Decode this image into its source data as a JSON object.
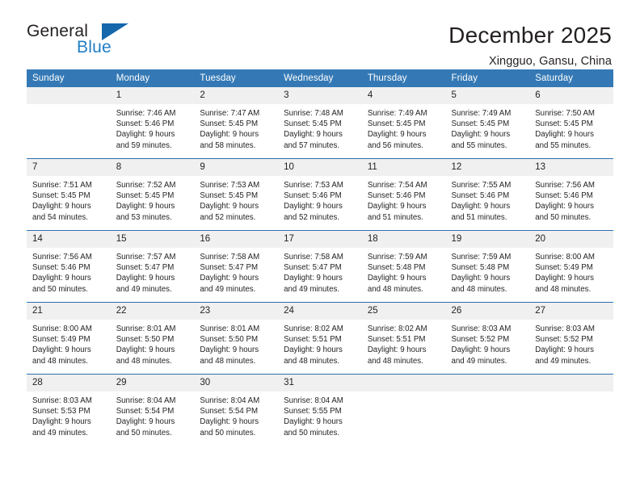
{
  "brand": {
    "name_part1": "General",
    "name_part2": "Blue",
    "triangle_color": "#1567ab",
    "blue_color": "#1f7ec4"
  },
  "header": {
    "month_title": "December 2025",
    "location": "Xingguo, Gansu, China",
    "header_bg": "#3479b5",
    "daynum_bg": "#f0f0f0",
    "row_divider": "#2f6fae"
  },
  "weekdays": [
    "Sunday",
    "Monday",
    "Tuesday",
    "Wednesday",
    "Thursday",
    "Friday",
    "Saturday"
  ],
  "labels": {
    "sunrise_prefix": "Sunrise:",
    "sunset_prefix": "Sunset:",
    "daylight_prefix": "Daylight:"
  },
  "weeks": [
    [
      {
        "day": "",
        "blank": true,
        "l1": "",
        "l2": "",
        "l3": "",
        "l4": ""
      },
      {
        "day": "1",
        "l1": "Sunrise: 7:46 AM",
        "l2": "Sunset: 5:46 PM",
        "l3": "Daylight: 9 hours",
        "l4": "and 59 minutes."
      },
      {
        "day": "2",
        "l1": "Sunrise: 7:47 AM",
        "l2": "Sunset: 5:45 PM",
        "l3": "Daylight: 9 hours",
        "l4": "and 58 minutes."
      },
      {
        "day": "3",
        "l1": "Sunrise: 7:48 AM",
        "l2": "Sunset: 5:45 PM",
        "l3": "Daylight: 9 hours",
        "l4": "and 57 minutes."
      },
      {
        "day": "4",
        "l1": "Sunrise: 7:49 AM",
        "l2": "Sunset: 5:45 PM",
        "l3": "Daylight: 9 hours",
        "l4": "and 56 minutes."
      },
      {
        "day": "5",
        "l1": "Sunrise: 7:49 AM",
        "l2": "Sunset: 5:45 PM",
        "l3": "Daylight: 9 hours",
        "l4": "and 55 minutes."
      },
      {
        "day": "6",
        "l1": "Sunrise: 7:50 AM",
        "l2": "Sunset: 5:45 PM",
        "l3": "Daylight: 9 hours",
        "l4": "and 55 minutes."
      }
    ],
    [
      {
        "day": "7",
        "l1": "Sunrise: 7:51 AM",
        "l2": "Sunset: 5:45 PM",
        "l3": "Daylight: 9 hours",
        "l4": "and 54 minutes."
      },
      {
        "day": "8",
        "l1": "Sunrise: 7:52 AM",
        "l2": "Sunset: 5:45 PM",
        "l3": "Daylight: 9 hours",
        "l4": "and 53 minutes."
      },
      {
        "day": "9",
        "l1": "Sunrise: 7:53 AM",
        "l2": "Sunset: 5:45 PM",
        "l3": "Daylight: 9 hours",
        "l4": "and 52 minutes."
      },
      {
        "day": "10",
        "l1": "Sunrise: 7:53 AM",
        "l2": "Sunset: 5:46 PM",
        "l3": "Daylight: 9 hours",
        "l4": "and 52 minutes."
      },
      {
        "day": "11",
        "l1": "Sunrise: 7:54 AM",
        "l2": "Sunset: 5:46 PM",
        "l3": "Daylight: 9 hours",
        "l4": "and 51 minutes."
      },
      {
        "day": "12",
        "l1": "Sunrise: 7:55 AM",
        "l2": "Sunset: 5:46 PM",
        "l3": "Daylight: 9 hours",
        "l4": "and 51 minutes."
      },
      {
        "day": "13",
        "l1": "Sunrise: 7:56 AM",
        "l2": "Sunset: 5:46 PM",
        "l3": "Daylight: 9 hours",
        "l4": "and 50 minutes."
      }
    ],
    [
      {
        "day": "14",
        "l1": "Sunrise: 7:56 AM",
        "l2": "Sunset: 5:46 PM",
        "l3": "Daylight: 9 hours",
        "l4": "and 50 minutes."
      },
      {
        "day": "15",
        "l1": "Sunrise: 7:57 AM",
        "l2": "Sunset: 5:47 PM",
        "l3": "Daylight: 9 hours",
        "l4": "and 49 minutes."
      },
      {
        "day": "16",
        "l1": "Sunrise: 7:58 AM",
        "l2": "Sunset: 5:47 PM",
        "l3": "Daylight: 9 hours",
        "l4": "and 49 minutes."
      },
      {
        "day": "17",
        "l1": "Sunrise: 7:58 AM",
        "l2": "Sunset: 5:47 PM",
        "l3": "Daylight: 9 hours",
        "l4": "and 49 minutes."
      },
      {
        "day": "18",
        "l1": "Sunrise: 7:59 AM",
        "l2": "Sunset: 5:48 PM",
        "l3": "Daylight: 9 hours",
        "l4": "and 48 minutes."
      },
      {
        "day": "19",
        "l1": "Sunrise: 7:59 AM",
        "l2": "Sunset: 5:48 PM",
        "l3": "Daylight: 9 hours",
        "l4": "and 48 minutes."
      },
      {
        "day": "20",
        "l1": "Sunrise: 8:00 AM",
        "l2": "Sunset: 5:49 PM",
        "l3": "Daylight: 9 hours",
        "l4": "and 48 minutes."
      }
    ],
    [
      {
        "day": "21",
        "l1": "Sunrise: 8:00 AM",
        "l2": "Sunset: 5:49 PM",
        "l3": "Daylight: 9 hours",
        "l4": "and 48 minutes."
      },
      {
        "day": "22",
        "l1": "Sunrise: 8:01 AM",
        "l2": "Sunset: 5:50 PM",
        "l3": "Daylight: 9 hours",
        "l4": "and 48 minutes."
      },
      {
        "day": "23",
        "l1": "Sunrise: 8:01 AM",
        "l2": "Sunset: 5:50 PM",
        "l3": "Daylight: 9 hours",
        "l4": "and 48 minutes."
      },
      {
        "day": "24",
        "l1": "Sunrise: 8:02 AM",
        "l2": "Sunset: 5:51 PM",
        "l3": "Daylight: 9 hours",
        "l4": "and 48 minutes."
      },
      {
        "day": "25",
        "l1": "Sunrise: 8:02 AM",
        "l2": "Sunset: 5:51 PM",
        "l3": "Daylight: 9 hours",
        "l4": "and 48 minutes."
      },
      {
        "day": "26",
        "l1": "Sunrise: 8:03 AM",
        "l2": "Sunset: 5:52 PM",
        "l3": "Daylight: 9 hours",
        "l4": "and 49 minutes."
      },
      {
        "day": "27",
        "l1": "Sunrise: 8:03 AM",
        "l2": "Sunset: 5:52 PM",
        "l3": "Daylight: 9 hours",
        "l4": "and 49 minutes."
      }
    ],
    [
      {
        "day": "28",
        "l1": "Sunrise: 8:03 AM",
        "l2": "Sunset: 5:53 PM",
        "l3": "Daylight: 9 hours",
        "l4": "and 49 minutes."
      },
      {
        "day": "29",
        "l1": "Sunrise: 8:04 AM",
        "l2": "Sunset: 5:54 PM",
        "l3": "Daylight: 9 hours",
        "l4": "and 50 minutes."
      },
      {
        "day": "30",
        "l1": "Sunrise: 8:04 AM",
        "l2": "Sunset: 5:54 PM",
        "l3": "Daylight: 9 hours",
        "l4": "and 50 minutes."
      },
      {
        "day": "31",
        "l1": "Sunrise: 8:04 AM",
        "l2": "Sunset: 5:55 PM",
        "l3": "Daylight: 9 hours",
        "l4": "and 50 minutes."
      },
      {
        "day": "",
        "blank": true,
        "l1": "",
        "l2": "",
        "l3": "",
        "l4": ""
      },
      {
        "day": "",
        "blank": true,
        "l1": "",
        "l2": "",
        "l3": "",
        "l4": ""
      },
      {
        "day": "",
        "blank": true,
        "l1": "",
        "l2": "",
        "l3": "",
        "l4": ""
      }
    ]
  ]
}
